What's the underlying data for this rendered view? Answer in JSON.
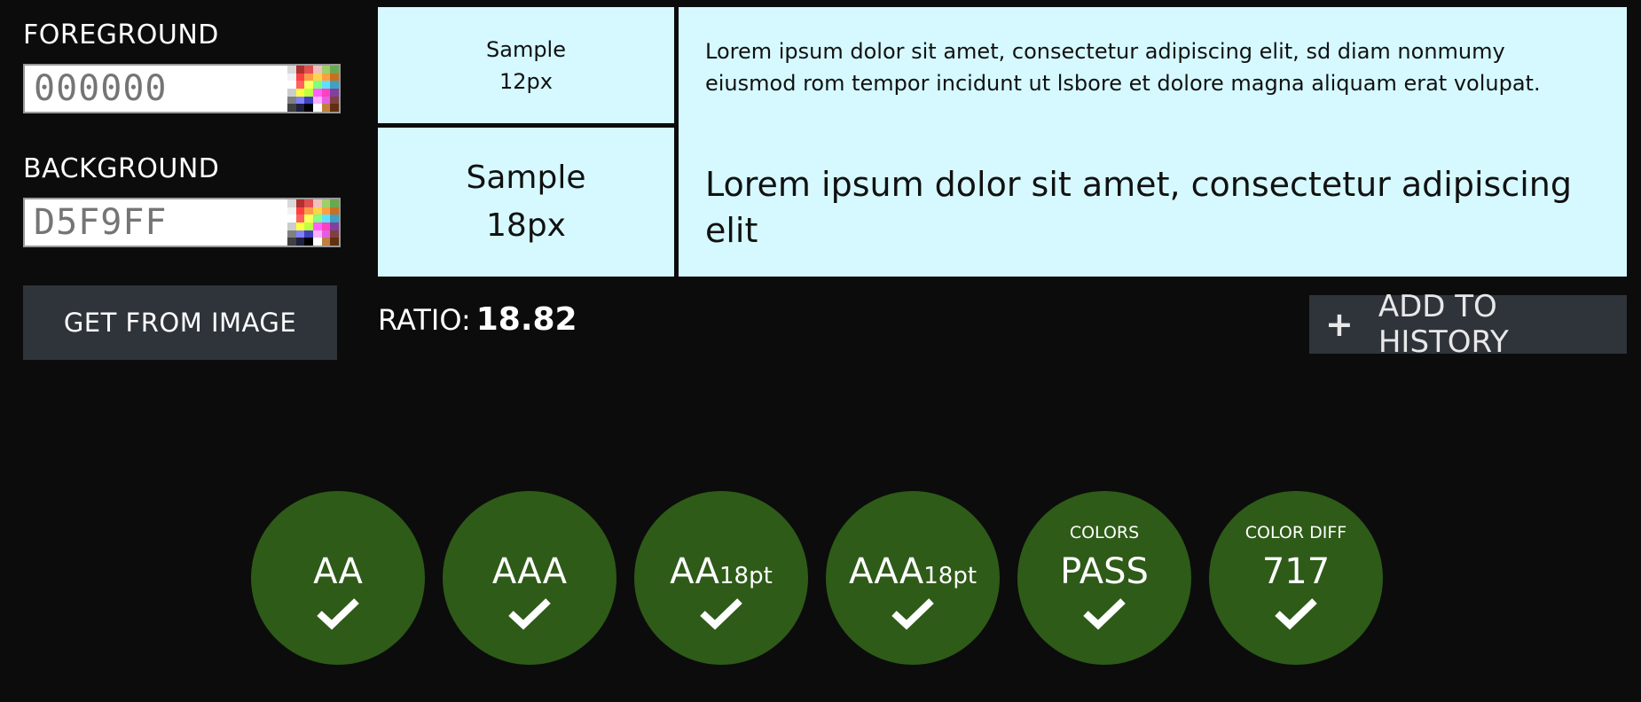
{
  "foreground": {
    "label": "FOREGROUND",
    "value": "",
    "placeholder": "000000",
    "color": "#000000"
  },
  "background": {
    "label": "BACKGROUND",
    "value": "",
    "placeholder": "D5F9FF",
    "color": "#D5F9FF"
  },
  "get_image_button": "GET FROM IMAGE",
  "samples": {
    "small_label_line1": "Sample",
    "small_label_line2": "12px",
    "large_label_line1": "Sample",
    "large_label_line2": "18px",
    "small_text": "Lorem ipsum dolor sit amet, consectetur adipiscing elit, sd diam nonmumy eiusmod rom tempor incidunt ut lsbore et dolore magna aliquam erat volupat.",
    "large_text": "Lorem ipsum dolor sit amet, consectetur adipiscing elit"
  },
  "ratio": {
    "label": "RATIO:",
    "value": "18.82"
  },
  "history_button": {
    "icon": "plus-icon",
    "label": "ADD TO HISTORY"
  },
  "badges": [
    {
      "top": "",
      "main": "AA",
      "sub": "",
      "icon": "check-icon"
    },
    {
      "top": "",
      "main": "AAA",
      "sub": "",
      "icon": "check-icon"
    },
    {
      "top": "",
      "main": "AA",
      "sub": "18pt",
      "icon": "check-icon"
    },
    {
      "top": "",
      "main": "AAA",
      "sub": "18pt",
      "icon": "check-icon"
    },
    {
      "top": "COLORS",
      "main": "PASS",
      "sub": "",
      "icon": "check-icon"
    },
    {
      "top": "COLOR DIFF",
      "main": "717",
      "sub": "",
      "icon": "check-icon"
    }
  ],
  "colors": {
    "badge_pass": "#2E5B18",
    "button_bg": "#2F343B",
    "page_bg": "#0C0C0C"
  }
}
